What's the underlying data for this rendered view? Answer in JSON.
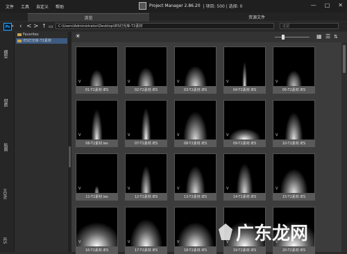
{
  "menu": [
    "文件",
    "工具",
    "自定义",
    "帮助"
  ],
  "app": {
    "title": "Project Manager 2.86.20",
    "stats": "| 项目: 500 | 选择: 0"
  },
  "window_buttons": [
    "—",
    "□",
    "✕"
  ],
  "tabs": {
    "browse": "浏览",
    "resources": "资源文件"
  },
  "address": {
    "path": "C:\\Users\\Administrator\\Desktop\\IES灯光库-T2素材",
    "filter_placeholder": "过滤"
  },
  "sidebar_labels": [
    "模型",
    "材质",
    "贴图",
    "HDRI",
    "IES"
  ],
  "tree": [
    {
      "label": "Favorites",
      "selected": false
    },
    {
      "label": "IES灯光库-T2素材",
      "selected": true
    }
  ],
  "view": {
    "thumb_size_fraction": 0.2
  },
  "thumbnails": [
    {
      "caption": "01-T2素材.IES",
      "tag": "V"
    },
    {
      "caption": "02-T2素材.IES",
      "tag": "V"
    },
    {
      "caption": "03-T2素材.IES",
      "tag": "V"
    },
    {
      "caption": "04-T2素材.IES",
      "tag": "V"
    },
    {
      "caption": "05-T2素材.IES",
      "tag": "V"
    },
    {
      "caption": "06-T2素材.ies",
      "tag": "V"
    },
    {
      "caption": "07-T2素材.IES",
      "tag": "V"
    },
    {
      "caption": "08-T2素材.IES",
      "tag": "V"
    },
    {
      "caption": "09-T2素材.IES",
      "tag": "V"
    },
    {
      "caption": "10-T2素材.IES",
      "tag": "V"
    },
    {
      "caption": "11-T2素材.ies",
      "tag": "V"
    },
    {
      "caption": "12-T2素材.IES",
      "tag": "V"
    },
    {
      "caption": "13-T2素材.IES",
      "tag": "V"
    },
    {
      "caption": "14-T2素材.IES",
      "tag": "V"
    },
    {
      "caption": "15-T2素材.IES",
      "tag": "V"
    },
    {
      "caption": "16-T2素材.IES",
      "tag": "V"
    },
    {
      "caption": "17-T2素材.IES",
      "tag": "V"
    },
    {
      "caption": "18-T2素材.IES",
      "tag": "V"
    },
    {
      "caption": "19-T2素材.IES",
      "tag": "V"
    },
    {
      "caption": "20-T2素材.IES",
      "tag": "V"
    }
  ],
  "watermark": "广东龙网",
  "colors": {
    "selection": "#3d5a80",
    "background": "#2b2b2b",
    "caption_bar": "#5a5a5a"
  }
}
